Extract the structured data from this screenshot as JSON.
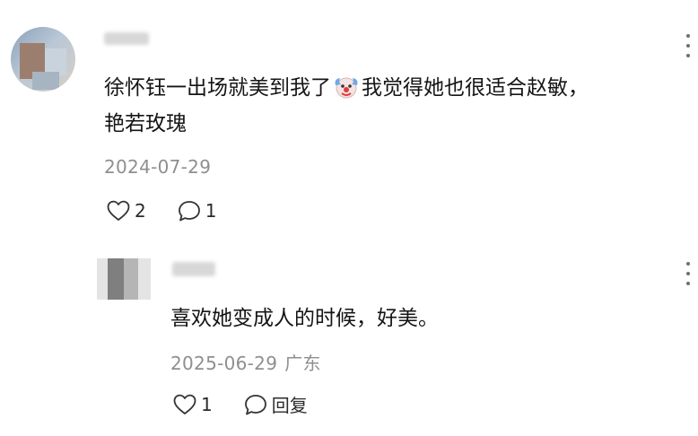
{
  "comments": [
    {
      "text_line1_a": "徐怀钰一出场就美到我了",
      "text_line1_b": "我觉得她也很适合赵敏，",
      "text_line2": "艳若玫瑰",
      "emoji": "clown-face-icon",
      "date": "2024-07-29",
      "like_count": "2",
      "reply_count": "1"
    }
  ],
  "reply": {
    "text": "喜欢她变成人的时候，好美。",
    "date": "2025-06-29",
    "region": "广东",
    "like_count": "1",
    "reply_label": "回复"
  },
  "icons": {
    "like": "heart-outline-icon",
    "reply": "speech-bubble-icon",
    "more": "more-vertical-icon"
  },
  "colors": {
    "text": "#151515",
    "meta": "#8f8f8f",
    "background": "#ffffff"
  }
}
